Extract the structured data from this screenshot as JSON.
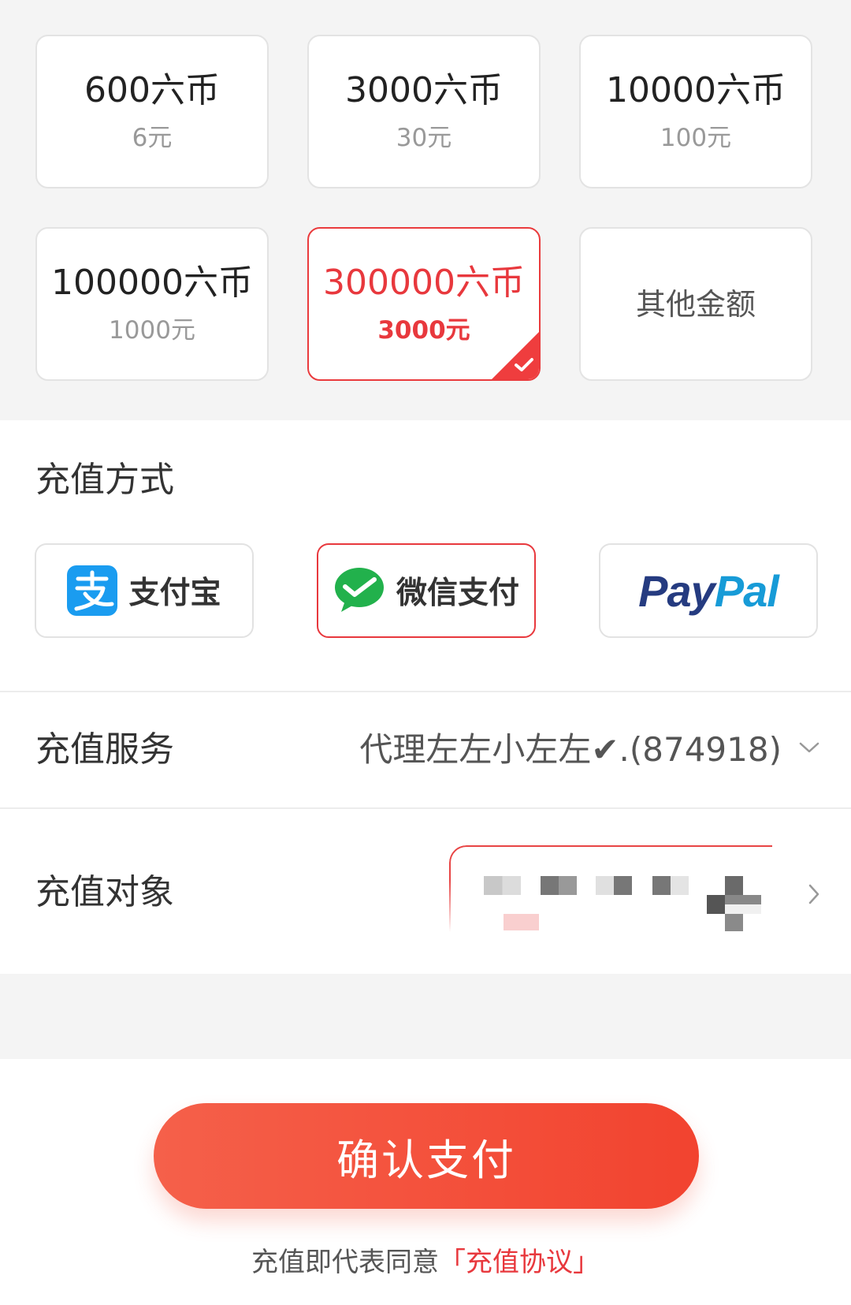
{
  "packages": [
    {
      "coins": "600六币",
      "price": "6元",
      "selected": false
    },
    {
      "coins": "3000六币",
      "price": "30元",
      "selected": false
    },
    {
      "coins": "10000六币",
      "price": "100元",
      "selected": false
    },
    {
      "coins": "100000六币",
      "price": "1000元",
      "selected": false
    },
    {
      "coins": "300000六币",
      "price": "3000元",
      "selected": true
    }
  ],
  "other_amount": "其他金额",
  "payment_section": {
    "title": "充值方式"
  },
  "payment_methods": [
    {
      "label": "支付宝",
      "icon": "alipay-icon",
      "selected": false
    },
    {
      "label": "微信支付",
      "icon": "wechat-pay-icon",
      "selected": true
    },
    {
      "logo_parts": [
        "Pay",
        "Pal"
      ],
      "icon": "paypal-logo",
      "selected": false
    }
  ],
  "service": {
    "label": "充值服务",
    "value": "代理左左小左左✔.(874918)",
    "icon": "chevron-down-icon"
  },
  "target": {
    "label": "充值对象",
    "icon": "chevron-right-icon"
  },
  "confirm_button": "确认支付",
  "agreement": {
    "prefix": "充值即代表同意",
    "link": "「充值协议」"
  },
  "colors": {
    "accent": "#e8383d",
    "button_gradient": [
      "#f5604a",
      "#f2432f"
    ],
    "alipay_blue": "#1a9cf0",
    "wechat_green": "#22b14c",
    "paypal_dark": "#253b80",
    "paypal_light": "#179bd7"
  }
}
